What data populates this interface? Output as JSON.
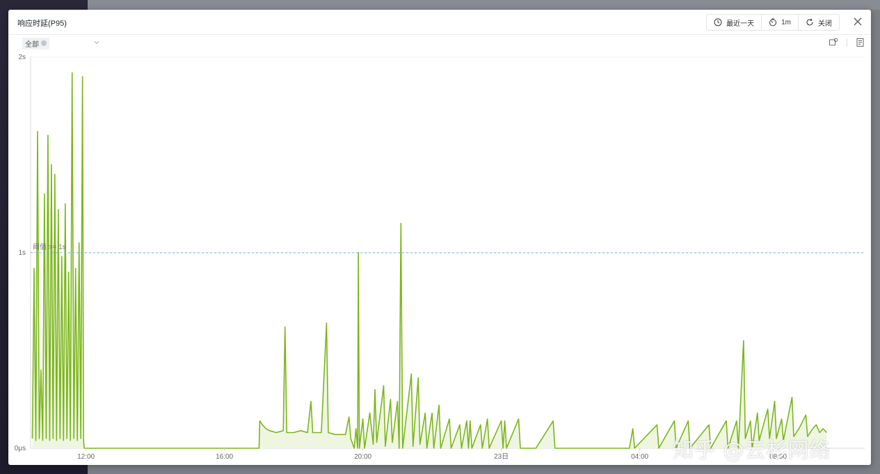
{
  "modal": {
    "title": "响应时延(P95)",
    "toolbar": {
      "range_label": "最近一天",
      "interval_label": "1m",
      "refresh_label": "关闭"
    }
  },
  "filter": {
    "selected": "全部"
  },
  "watermark": "知乎 @云杉网络",
  "colors": {
    "series": "#7cb51c",
    "fill": "#eef6e2",
    "threshold": "#5fb8e0",
    "grid": "#eeeeee"
  },
  "chart_data": {
    "type": "line",
    "y_ticks": [
      {
        "value": 0,
        "label": "0μs"
      },
      {
        "value": 1,
        "label": "1s"
      },
      {
        "value": 2,
        "label": "2s"
      }
    ],
    "x_ticks": [
      {
        "value": 12,
        "label": "12:00"
      },
      {
        "value": 16,
        "label": "16:00"
      },
      {
        "value": 20,
        "label": "20:00"
      },
      {
        "value": 24,
        "label": "23日"
      },
      {
        "value": 28,
        "label": "04:00"
      },
      {
        "value": 32,
        "label": "08:00"
      }
    ],
    "ylim": [
      0,
      2
    ],
    "xlim": [
      10.4,
      34.5
    ],
    "threshold": {
      "value": 1,
      "label": "阈值 >= 1s"
    },
    "grid": true,
    "series": [
      {
        "values_hint": "P95 latency in seconds, x = hour of day",
        "points": [
          [
            10.45,
            0.05
          ],
          [
            10.5,
            0.92
          ],
          [
            10.55,
            0.04
          ],
          [
            10.6,
            1.62
          ],
          [
            10.65,
            0.05
          ],
          [
            10.7,
            0.4
          ],
          [
            10.75,
            0.04
          ],
          [
            10.8,
            1.3
          ],
          [
            10.85,
            0.05
          ],
          [
            10.9,
            1.6
          ],
          [
            10.95,
            0.04
          ],
          [
            11.0,
            1.45
          ],
          [
            11.05,
            0.05
          ],
          [
            11.1,
            1.4
          ],
          [
            11.15,
            0.04
          ],
          [
            11.2,
            1.22
          ],
          [
            11.25,
            0.05
          ],
          [
            11.3,
            0.98
          ],
          [
            11.35,
            0.04
          ],
          [
            11.4,
            1.25
          ],
          [
            11.45,
            0.05
          ],
          [
            11.5,
            0.9
          ],
          [
            11.55,
            0.04
          ],
          [
            11.6,
            1.92
          ],
          [
            11.65,
            0.05
          ],
          [
            11.7,
            0.92
          ],
          [
            11.75,
            0.04
          ],
          [
            11.8,
            1.05
          ],
          [
            11.85,
            0.05
          ],
          [
            11.9,
            1.9
          ],
          [
            11.93,
            0.04
          ],
          [
            11.95,
            0.0
          ],
          [
            17.0,
            0.0
          ],
          [
            17.02,
            0.14
          ],
          [
            17.1,
            0.12
          ],
          [
            17.2,
            0.1
          ],
          [
            17.3,
            0.09
          ],
          [
            17.5,
            0.08
          ],
          [
            17.7,
            0.09
          ],
          [
            17.75,
            0.62
          ],
          [
            17.8,
            0.08
          ],
          [
            18.0,
            0.08
          ],
          [
            18.2,
            0.09
          ],
          [
            18.4,
            0.08
          ],
          [
            18.5,
            0.24
          ],
          [
            18.55,
            0.08
          ],
          [
            18.8,
            0.08
          ],
          [
            18.95,
            0.64
          ],
          [
            19.0,
            0.08
          ],
          [
            19.2,
            0.07
          ],
          [
            19.5,
            0.07
          ],
          [
            19.6,
            0.16
          ],
          [
            19.65,
            0.05
          ],
          [
            19.75,
            0.0
          ],
          [
            19.8,
            0.1
          ],
          [
            19.85,
            0.0
          ],
          [
            19.87,
            1.0
          ],
          [
            19.9,
            0.0
          ],
          [
            20.0,
            0.15
          ],
          [
            20.05,
            0.0
          ],
          [
            20.2,
            0.18
          ],
          [
            20.3,
            0.02
          ],
          [
            20.35,
            0.3
          ],
          [
            20.4,
            0.03
          ],
          [
            20.6,
            0.32
          ],
          [
            20.65,
            0.01
          ],
          [
            20.8,
            0.25
          ],
          [
            20.85,
            0.03
          ],
          [
            21.0,
            0.24
          ],
          [
            21.05,
            0.0
          ],
          [
            21.1,
            1.15
          ],
          [
            21.15,
            0.0
          ],
          [
            21.4,
            0.38
          ],
          [
            21.45,
            0.01
          ],
          [
            21.6,
            0.36
          ],
          [
            21.65,
            0.02
          ],
          [
            21.8,
            0.18
          ],
          [
            21.85,
            0.0
          ],
          [
            22.0,
            0.18
          ],
          [
            22.05,
            0.0
          ],
          [
            22.2,
            0.22
          ],
          [
            22.25,
            0.0
          ],
          [
            22.5,
            0.15
          ],
          [
            22.55,
            0.0
          ],
          [
            22.8,
            0.12
          ],
          [
            22.85,
            0.0
          ],
          [
            23.0,
            0.14
          ],
          [
            23.05,
            0.0
          ],
          [
            23.1,
            0.14
          ],
          [
            23.15,
            0.0
          ],
          [
            23.4,
            0.12
          ],
          [
            23.45,
            0.0
          ],
          [
            23.6,
            0.15
          ],
          [
            23.65,
            0.0
          ],
          [
            24.0,
            0.14
          ],
          [
            24.05,
            0.0
          ],
          [
            24.1,
            0.14
          ],
          [
            24.15,
            0.0
          ],
          [
            24.5,
            0.15
          ],
          [
            24.55,
            0.0
          ],
          [
            25.0,
            0.0
          ],
          [
            25.5,
            0.14
          ],
          [
            25.55,
            0.0
          ],
          [
            27.7,
            0.0
          ],
          [
            27.8,
            0.1
          ],
          [
            27.85,
            0.0
          ],
          [
            28.5,
            0.12
          ],
          [
            28.55,
            0.0
          ],
          [
            29.0,
            0.14
          ],
          [
            29.05,
            0.0
          ],
          [
            29.4,
            0.14
          ],
          [
            29.45,
            0.0
          ],
          [
            30.0,
            0.12
          ],
          [
            30.05,
            0.0
          ],
          [
            30.5,
            0.14
          ],
          [
            30.55,
            0.0
          ],
          [
            30.8,
            0.14
          ],
          [
            30.85,
            0.0
          ],
          [
            31.0,
            0.55
          ],
          [
            31.05,
            0.05
          ],
          [
            31.2,
            0.14
          ],
          [
            31.25,
            0.0
          ],
          [
            31.4,
            0.18
          ],
          [
            31.45,
            0.04
          ],
          [
            31.7,
            0.2
          ],
          [
            31.75,
            0.05
          ],
          [
            31.9,
            0.24
          ],
          [
            31.95,
            0.05
          ],
          [
            32.1,
            0.15
          ],
          [
            32.15,
            0.04
          ],
          [
            32.4,
            0.26
          ],
          [
            32.45,
            0.06
          ],
          [
            32.6,
            0.1
          ],
          [
            32.8,
            0.17
          ],
          [
            32.85,
            0.06
          ],
          [
            33.0,
            0.1
          ],
          [
            33.1,
            0.12
          ],
          [
            33.2,
            0.08
          ],
          [
            33.3,
            0.1
          ],
          [
            33.4,
            0.08
          ]
        ]
      }
    ]
  }
}
